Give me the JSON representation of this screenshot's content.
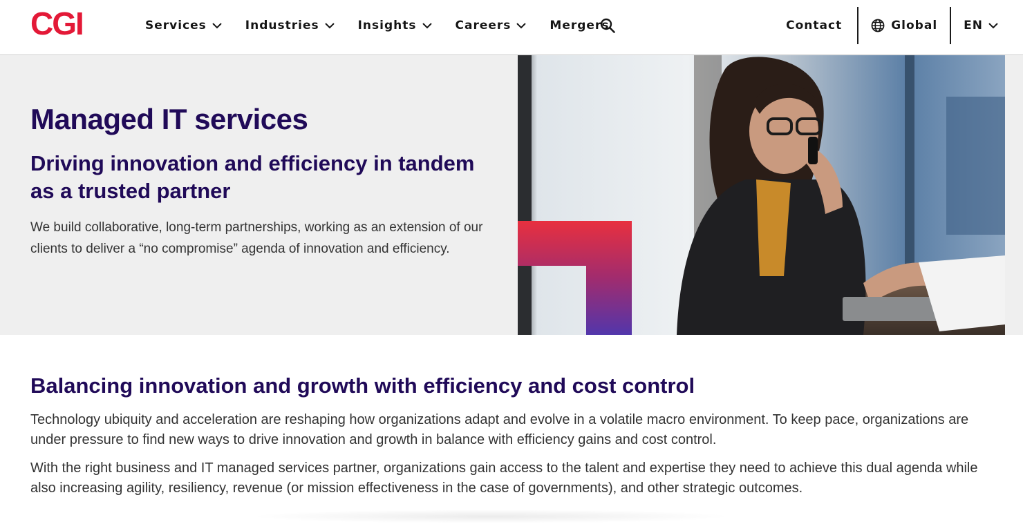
{
  "header": {
    "logo_text": "CGI",
    "nav": [
      {
        "label": "Services",
        "has_dropdown": true
      },
      {
        "label": "Industries",
        "has_dropdown": true
      },
      {
        "label": "Insights",
        "has_dropdown": true
      },
      {
        "label": "Careers",
        "has_dropdown": true
      },
      {
        "label": "Mergers",
        "has_dropdown": false
      }
    ],
    "contact_label": "Contact",
    "global_label": "Global",
    "lang_label": "EN"
  },
  "hero": {
    "title": "Managed IT services",
    "subtitle": "Driving innovation and efficiency in tandem as a trusted partner",
    "body": "We build collaborative, long-term partnerships, working as an extension of our clients to deliver a “no compromise” agenda of innovation and efficiency."
  },
  "content": {
    "heading": "Balancing innovation and growth with efficiency and cost control",
    "paragraph1": "Technology ubiquity and acceleration are reshaping how organizations adapt and evolve in a volatile macro environment. To keep pace, organizations are under pressure to find new ways to drive innovation and growth in balance with efficiency gains and cost control.",
    "paragraph2": "With the right business and IT managed services partner, organizations gain access to the talent and expertise they need to achieve this dual agenda while also increasing agility, resiliency, revenue (or mission effectiveness in the case of governments), and other strategic outcomes."
  },
  "colors": {
    "brand_red": "#e31937",
    "heading_navy": "#200a58",
    "accent_purple": "#5236ab"
  },
  "icons": [
    "chevron-down-icon",
    "search-icon",
    "globe-icon"
  ]
}
